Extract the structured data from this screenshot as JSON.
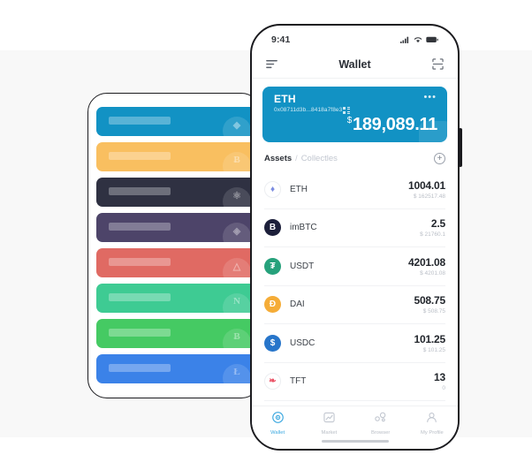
{
  "backdrop": {
    "color": "#f8f8f8"
  },
  "left_phone": {
    "name": "wallet-card-stack-preview",
    "cards": [
      {
        "color": "#1292c4",
        "glyph": "◆",
        "token": "eth"
      },
      {
        "color": "#f9bf60",
        "glyph": "Ƀ",
        "token": "btc"
      },
      {
        "color": "#2f3142",
        "glyph": "⚛",
        "token": "atom"
      },
      {
        "color": "#4d4469",
        "glyph": "◈",
        "token": "eos"
      },
      {
        "color": "#e06a63",
        "glyph": "△",
        "token": "tron"
      },
      {
        "color": "#3ecb93",
        "glyph": "N",
        "token": "neo"
      },
      {
        "color": "#45ca63",
        "glyph": "Ƀ",
        "token": "bch"
      },
      {
        "color": "#3b82e8",
        "glyph": "Ł",
        "token": "ltc"
      }
    ]
  },
  "right_phone": {
    "status_bar": {
      "time": "9:41",
      "icons": [
        "signal-icon",
        "wifi-icon",
        "battery-icon"
      ]
    },
    "nav": {
      "menu_icon": "hamburger-menu-icon",
      "title": "Wallet",
      "scan_icon": "scan-qr-icon"
    },
    "balance_card": {
      "symbol": "ETH",
      "address": "0x08711d3b...8418a7f8e3",
      "qr_icon": "qr-code-icon",
      "more_icon": "more-options-icon",
      "currency": "$",
      "amount": "189,089.11",
      "background": "#1292c4"
    },
    "tabs": {
      "assets_label": "Assets",
      "separator": "/",
      "collectibles_label": "Collectles",
      "add_label": "+"
    },
    "assets": [
      {
        "name": "ETH",
        "amount": "1004.01",
        "fiat": "$ 162517.48",
        "icon_bg": "#ffffff",
        "icon_fg": "#7b8ce0",
        "glyph": "♦"
      },
      {
        "name": "imBTC",
        "amount": "2.5",
        "fiat": "$ 21760.1",
        "icon_bg": "#1c1f3a",
        "icon_fg": "#ffffff",
        "glyph": "B"
      },
      {
        "name": "USDT",
        "amount": "4201.08",
        "fiat": "$ 4201.08",
        "icon_bg": "#26a17b",
        "icon_fg": "#ffffff",
        "glyph": "₮"
      },
      {
        "name": "DAI",
        "amount": "508.75",
        "fiat": "$ 508.75",
        "icon_bg": "#f5ac37",
        "icon_fg": "#ffffff",
        "glyph": "Ð"
      },
      {
        "name": "USDC",
        "amount": "101.25",
        "fiat": "$ 101.25",
        "icon_bg": "#2775ca",
        "icon_fg": "#ffffff",
        "glyph": "$"
      },
      {
        "name": "TFT",
        "amount": "13",
        "fiat": "0",
        "icon_bg": "#ffffff",
        "icon_fg": "#ea4f63",
        "glyph": "❧"
      }
    ],
    "tabbar": [
      {
        "label": "Wallet",
        "icon": "wallet-icon",
        "active": true
      },
      {
        "label": "Market",
        "icon": "market-icon",
        "active": false
      },
      {
        "label": "Browser",
        "icon": "browser-icon",
        "active": false
      },
      {
        "label": "My Profile",
        "icon": "profile-icon",
        "active": false
      }
    ],
    "accent_color": "#3ba8e0"
  }
}
